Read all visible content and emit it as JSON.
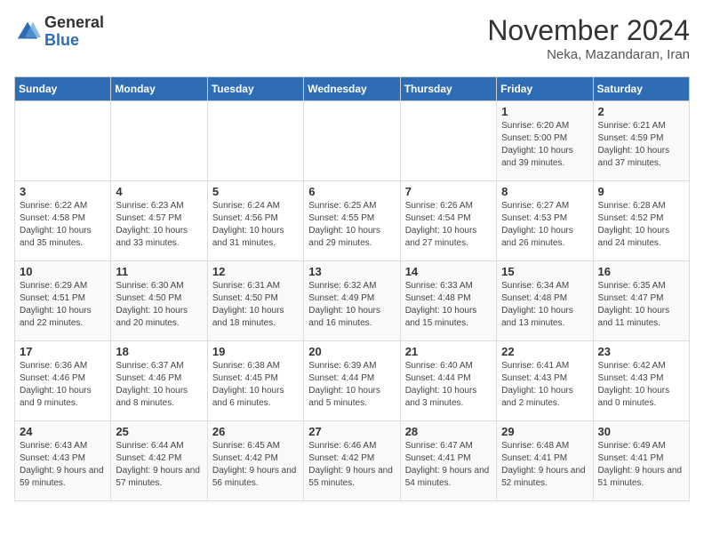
{
  "logo": {
    "general": "General",
    "blue": "Blue"
  },
  "title": "November 2024",
  "subtitle": "Neka, Mazandaran, Iran",
  "days_of_week": [
    "Sunday",
    "Monday",
    "Tuesday",
    "Wednesday",
    "Thursday",
    "Friday",
    "Saturday"
  ],
  "weeks": [
    [
      {
        "day": "",
        "info": ""
      },
      {
        "day": "",
        "info": ""
      },
      {
        "day": "",
        "info": ""
      },
      {
        "day": "",
        "info": ""
      },
      {
        "day": "",
        "info": ""
      },
      {
        "day": "1",
        "info": "Sunrise: 6:20 AM\nSunset: 5:00 PM\nDaylight: 10 hours and 39 minutes."
      },
      {
        "day": "2",
        "info": "Sunrise: 6:21 AM\nSunset: 4:59 PM\nDaylight: 10 hours and 37 minutes."
      }
    ],
    [
      {
        "day": "3",
        "info": "Sunrise: 6:22 AM\nSunset: 4:58 PM\nDaylight: 10 hours and 35 minutes."
      },
      {
        "day": "4",
        "info": "Sunrise: 6:23 AM\nSunset: 4:57 PM\nDaylight: 10 hours and 33 minutes."
      },
      {
        "day": "5",
        "info": "Sunrise: 6:24 AM\nSunset: 4:56 PM\nDaylight: 10 hours and 31 minutes."
      },
      {
        "day": "6",
        "info": "Sunrise: 6:25 AM\nSunset: 4:55 PM\nDaylight: 10 hours and 29 minutes."
      },
      {
        "day": "7",
        "info": "Sunrise: 6:26 AM\nSunset: 4:54 PM\nDaylight: 10 hours and 27 minutes."
      },
      {
        "day": "8",
        "info": "Sunrise: 6:27 AM\nSunset: 4:53 PM\nDaylight: 10 hours and 26 minutes."
      },
      {
        "day": "9",
        "info": "Sunrise: 6:28 AM\nSunset: 4:52 PM\nDaylight: 10 hours and 24 minutes."
      }
    ],
    [
      {
        "day": "10",
        "info": "Sunrise: 6:29 AM\nSunset: 4:51 PM\nDaylight: 10 hours and 22 minutes."
      },
      {
        "day": "11",
        "info": "Sunrise: 6:30 AM\nSunset: 4:50 PM\nDaylight: 10 hours and 20 minutes."
      },
      {
        "day": "12",
        "info": "Sunrise: 6:31 AM\nSunset: 4:50 PM\nDaylight: 10 hours and 18 minutes."
      },
      {
        "day": "13",
        "info": "Sunrise: 6:32 AM\nSunset: 4:49 PM\nDaylight: 10 hours and 16 minutes."
      },
      {
        "day": "14",
        "info": "Sunrise: 6:33 AM\nSunset: 4:48 PM\nDaylight: 10 hours and 15 minutes."
      },
      {
        "day": "15",
        "info": "Sunrise: 6:34 AM\nSunset: 4:48 PM\nDaylight: 10 hours and 13 minutes."
      },
      {
        "day": "16",
        "info": "Sunrise: 6:35 AM\nSunset: 4:47 PM\nDaylight: 10 hours and 11 minutes."
      }
    ],
    [
      {
        "day": "17",
        "info": "Sunrise: 6:36 AM\nSunset: 4:46 PM\nDaylight: 10 hours and 9 minutes."
      },
      {
        "day": "18",
        "info": "Sunrise: 6:37 AM\nSunset: 4:46 PM\nDaylight: 10 hours and 8 minutes."
      },
      {
        "day": "19",
        "info": "Sunrise: 6:38 AM\nSunset: 4:45 PM\nDaylight: 10 hours and 6 minutes."
      },
      {
        "day": "20",
        "info": "Sunrise: 6:39 AM\nSunset: 4:44 PM\nDaylight: 10 hours and 5 minutes."
      },
      {
        "day": "21",
        "info": "Sunrise: 6:40 AM\nSunset: 4:44 PM\nDaylight: 10 hours and 3 minutes."
      },
      {
        "day": "22",
        "info": "Sunrise: 6:41 AM\nSunset: 4:43 PM\nDaylight: 10 hours and 2 minutes."
      },
      {
        "day": "23",
        "info": "Sunrise: 6:42 AM\nSunset: 4:43 PM\nDaylight: 10 hours and 0 minutes."
      }
    ],
    [
      {
        "day": "24",
        "info": "Sunrise: 6:43 AM\nSunset: 4:43 PM\nDaylight: 9 hours and 59 minutes."
      },
      {
        "day": "25",
        "info": "Sunrise: 6:44 AM\nSunset: 4:42 PM\nDaylight: 9 hours and 57 minutes."
      },
      {
        "day": "26",
        "info": "Sunrise: 6:45 AM\nSunset: 4:42 PM\nDaylight: 9 hours and 56 minutes."
      },
      {
        "day": "27",
        "info": "Sunrise: 6:46 AM\nSunset: 4:42 PM\nDaylight: 9 hours and 55 minutes."
      },
      {
        "day": "28",
        "info": "Sunrise: 6:47 AM\nSunset: 4:41 PM\nDaylight: 9 hours and 54 minutes."
      },
      {
        "day": "29",
        "info": "Sunrise: 6:48 AM\nSunset: 4:41 PM\nDaylight: 9 hours and 52 minutes."
      },
      {
        "day": "30",
        "info": "Sunrise: 6:49 AM\nSunset: 4:41 PM\nDaylight: 9 hours and 51 minutes."
      }
    ]
  ]
}
